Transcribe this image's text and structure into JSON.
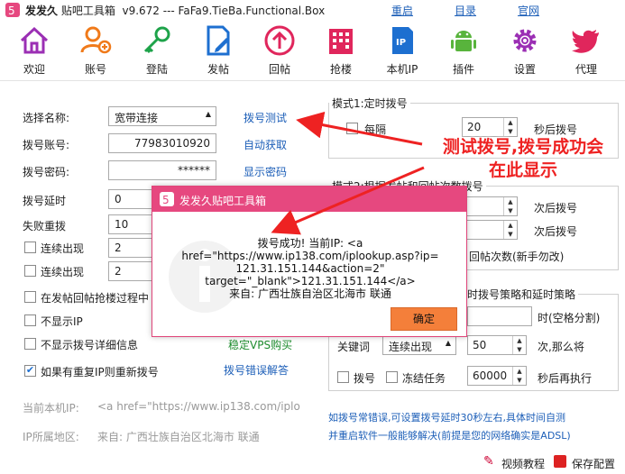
{
  "titlebar": {
    "app": "发发久",
    "title": "贴吧工具箱  v9.672 --- FaFa9.TieBa.Functional.Box",
    "links": [
      "重启",
      "目录",
      "官网"
    ]
  },
  "toolbar": [
    "欢迎",
    "账号",
    "登陆",
    "发帖",
    "回帖",
    "抢楼",
    "本机IP",
    "插件",
    "设置",
    "代理"
  ],
  "left": {
    "name_label": "选择名称:",
    "name_value": "宽带连接",
    "dial_test": "拨号测试",
    "account_label": "拨号账号:",
    "account_value": "77983010920",
    "auto_get": "自动获取",
    "password_label": "拨号密码:",
    "password_value": "******",
    "show_pw": "显示密码",
    "delay_label": "拨号延时",
    "delay_value": "0",
    "fail_label": "失败重拨",
    "fail_value": "10",
    "cont1": "连续出现",
    "cont1_value": "2",
    "cont2": "连续出现",
    "cont2_value": "2",
    "rush": "在发帖回帖抢楼过程中",
    "no_ip": "不显示IP",
    "no_detail": "不显示拨号详细信息",
    "vps": "稳定VPS购买",
    "repeat_ip": "如果有重复IP则重新拨号",
    "err_help": "拨号错误解答",
    "local_ip_label": "当前本机IP:",
    "local_ip_value": "<a href=\"https://www.ip138.com/iplo",
    "region_label": "IP所属地区:",
    "region_value": "来自: 广西壮族自治区北海市 联通"
  },
  "right": {
    "mode1": "模式1:定时拨号",
    "every": "每隔",
    "every_value": "20",
    "after_sec": "秒后拨号",
    "mode2": "模式2:根据发帖和回帖次数拨号",
    "after_post": "次后拨号",
    "after_reply": "次后拨号",
    "reply_count": "回帖次数(新手勿改)",
    "strategy": "时拨号策略和延时策略",
    "time_sep": "时(空格分割)",
    "keyword": "关键词",
    "keyword_mode": "连续出现",
    "keyword_count": "50",
    "then": "次,那么将",
    "dial_chk": "拨号",
    "freeze_chk": "冻结任务",
    "exec_value": "60000",
    "exec_after": "秒后再执行",
    "tip": "如拨号常错误,可设置拨号延时30秒左右,具体时间自测\n并重启软件一般能够解决(前提是您的网络确实是ADSL)"
  },
  "statusbar": {
    "video": "视频教程",
    "save": "保存配置"
  },
  "dialog": {
    "title": "发发久贴吧工具箱",
    "line1": "拨号成功! 当前IP: <a",
    "line2": "href=\"https://www.ip138.com/iplookup.asp?ip=",
    "line3": "121.31.151.144&action=2\"",
    "line4": "target=\"_blank\">121.31.151.144</a>",
    "line5": "来自: 广西壮族自治区北海市 联通",
    "ok": "确定"
  },
  "annotation": {
    "line1": "测试拨号,拨号成功会",
    "line2": "在此显示"
  },
  "colors": {
    "toolbar_icon": "#9b2fb4",
    "link": "#1d5fb8",
    "dialog_title": "#e6487f",
    "ok_button": "#f47f3a",
    "annotation": "#e22222"
  }
}
